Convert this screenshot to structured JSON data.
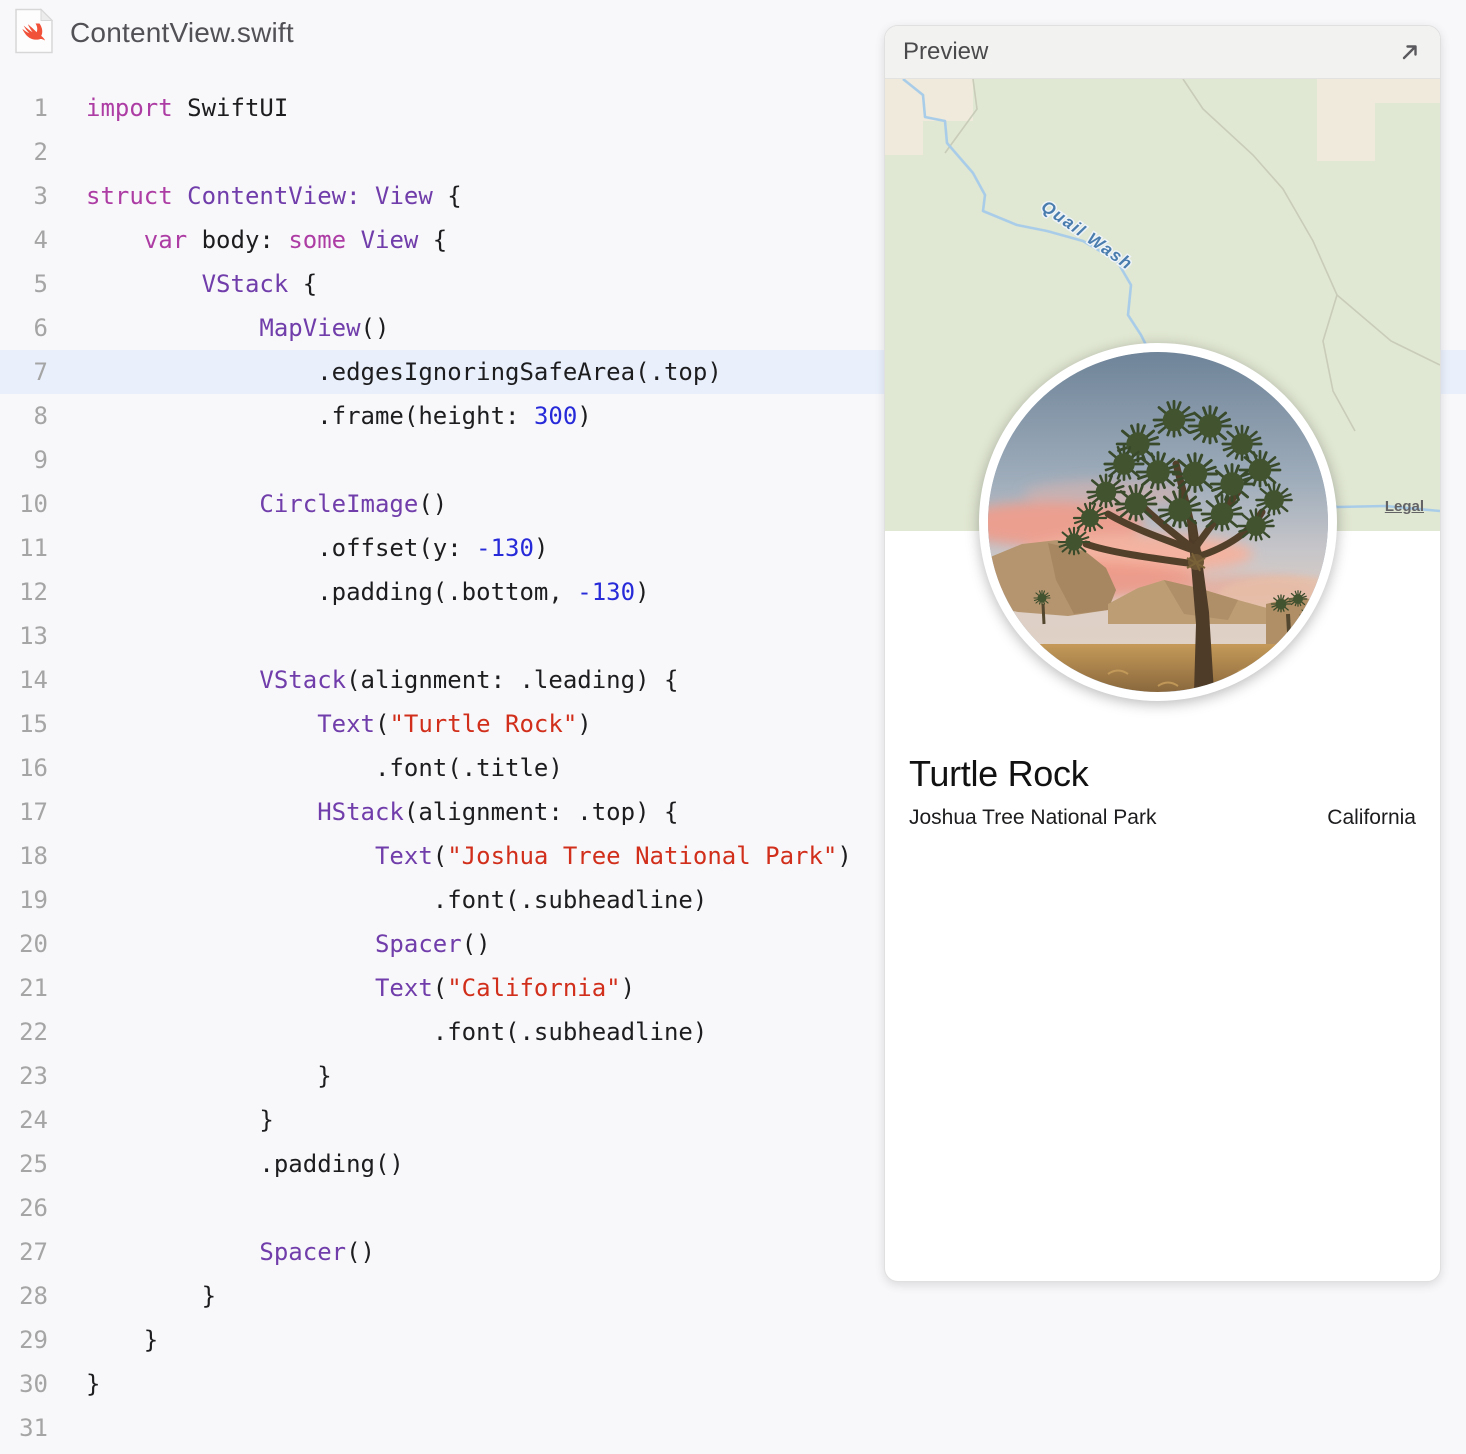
{
  "header": {
    "file_name": "ContentView.swift",
    "file_icon": "swift-file-icon"
  },
  "editor": {
    "highlighted_line": 7,
    "highlight_color": "#e9f0fc",
    "colors": {
      "keyword": "#ad3da4",
      "type": "#703daa",
      "string": "#d12f1b",
      "number": "#272ad8",
      "plain": "#1d1d1f",
      "line_number": "#a5a5a5"
    },
    "token_classes": {
      "k": "keyword",
      "t": "type",
      "s": "string",
      "n": "number",
      "p": "plain"
    },
    "lines": [
      [
        [
          "import",
          "k"
        ],
        [
          " SwiftUI",
          "p"
        ]
      ],
      [],
      [
        [
          "struct",
          "k"
        ],
        [
          " ",
          "p"
        ],
        [
          "ContentView:",
          "t"
        ],
        [
          " ",
          "p"
        ],
        [
          "View",
          "t"
        ],
        [
          " {",
          "p"
        ]
      ],
      [
        [
          "    ",
          "p"
        ],
        [
          "var",
          "k"
        ],
        [
          " body: ",
          "p"
        ],
        [
          "some",
          "k"
        ],
        [
          " ",
          "p"
        ],
        [
          "View",
          "t"
        ],
        [
          " {",
          "p"
        ]
      ],
      [
        [
          "        ",
          "p"
        ],
        [
          "VStack",
          "t"
        ],
        [
          " {",
          "p"
        ]
      ],
      [
        [
          "            ",
          "p"
        ],
        [
          "MapView",
          "t"
        ],
        [
          "()",
          "p"
        ]
      ],
      [
        [
          "                .edgesIgnoringSafeArea(.top)",
          "p"
        ]
      ],
      [
        [
          "                .frame(height: ",
          "p"
        ],
        [
          "300",
          "n"
        ],
        [
          ")",
          "p"
        ]
      ],
      [],
      [
        [
          "            ",
          "p"
        ],
        [
          "CircleImage",
          "t"
        ],
        [
          "()",
          "p"
        ]
      ],
      [
        [
          "                .offset(y: ",
          "p"
        ],
        [
          "-130",
          "n"
        ],
        [
          ")",
          "p"
        ]
      ],
      [
        [
          "                .padding(.bottom, ",
          "p"
        ],
        [
          "-130",
          "n"
        ],
        [
          ")",
          "p"
        ]
      ],
      [],
      [
        [
          "            ",
          "p"
        ],
        [
          "VStack",
          "t"
        ],
        [
          "(alignment: .leading) {",
          "p"
        ]
      ],
      [
        [
          "                ",
          "p"
        ],
        [
          "Text",
          "t"
        ],
        [
          "(",
          "p"
        ],
        [
          "\"Turtle Rock\"",
          "s"
        ],
        [
          ")",
          "p"
        ]
      ],
      [
        [
          "                    .font(.title)",
          "p"
        ]
      ],
      [
        [
          "                ",
          "p"
        ],
        [
          "HStack",
          "t"
        ],
        [
          "(alignment: .top) {",
          "p"
        ]
      ],
      [
        [
          "                    ",
          "p"
        ],
        [
          "Text",
          "t"
        ],
        [
          "(",
          "p"
        ],
        [
          "\"Joshua Tree National Park\"",
          "s"
        ],
        [
          ")",
          "p"
        ]
      ],
      [
        [
          "                        .font(.subheadline)",
          "p"
        ]
      ],
      [
        [
          "                    ",
          "p"
        ],
        [
          "Spacer",
          "t"
        ],
        [
          "()",
          "p"
        ]
      ],
      [
        [
          "                    ",
          "p"
        ],
        [
          "Text",
          "t"
        ],
        [
          "(",
          "p"
        ],
        [
          "\"California\"",
          "s"
        ],
        [
          ")",
          "p"
        ]
      ],
      [
        [
          "                        .font(.subheadline)",
          "p"
        ]
      ],
      [
        [
          "                }",
          "p"
        ]
      ],
      [
        [
          "            }",
          "p"
        ]
      ],
      [
        [
          "            .padding()",
          "p"
        ]
      ],
      [],
      [
        [
          "            ",
          "p"
        ],
        [
          "Spacer",
          "t"
        ],
        [
          "()",
          "p"
        ]
      ],
      [
        [
          "        }",
          "p"
        ]
      ],
      [
        [
          "    }",
          "p"
        ]
      ],
      [
        [
          "}",
          "p"
        ]
      ],
      []
    ]
  },
  "preview": {
    "title": "Preview",
    "expand_icon": "open-in-new-icon",
    "map": {
      "water_label": "Quail Wash",
      "legal_label": "Legal",
      "land_color": "#e0e7d2",
      "desert_color": "#efeadb",
      "water_color": "#a9cde9",
      "water_label_color": "#4a7dae"
    },
    "detail": {
      "title": "Turtle Rock",
      "park": "Joshua Tree National Park",
      "state": "California"
    }
  },
  "page": {
    "background": "#f8f8fa"
  }
}
